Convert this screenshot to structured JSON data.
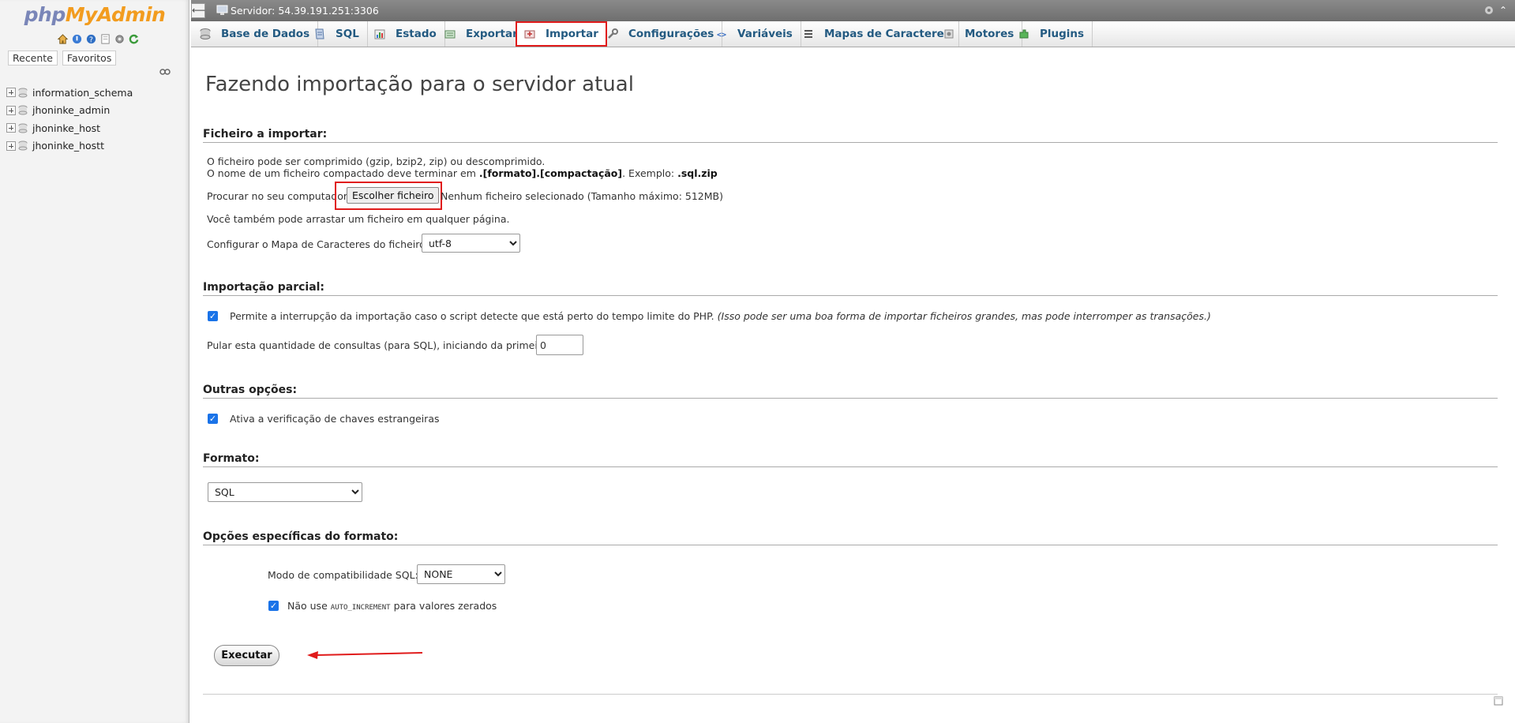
{
  "nav": {
    "logo": {
      "php": "php",
      "myadmin": "MyAdmin"
    },
    "tabs": {
      "recent": "Recente",
      "favorites": "Favoritos"
    },
    "databases": [
      "information_schema",
      "jhoninke_admin",
      "jhoninke_host",
      "jhoninke_hostt"
    ]
  },
  "server_bar": {
    "label": "Servidor: 54.39.191.251:3306"
  },
  "tabs": [
    {
      "label": "Base de Dados",
      "icon": "database-icon"
    },
    {
      "label": "SQL",
      "icon": "sql-icon"
    },
    {
      "label": "Estado",
      "icon": "status-icon"
    },
    {
      "label": "Exportar",
      "icon": "export-icon"
    },
    {
      "label": "Importar",
      "icon": "import-icon",
      "active": true
    },
    {
      "label": "Configurações",
      "icon": "wrench-icon"
    },
    {
      "label": "Variáveis",
      "icon": "variables-icon"
    },
    {
      "label": "Mapas de Caracteres",
      "icon": "charset-icon"
    },
    {
      "label": "Motores",
      "icon": "engine-icon"
    },
    {
      "label": "Plugins",
      "icon": "plugin-icon"
    }
  ],
  "page": {
    "title": "Fazendo importação para o servidor atual",
    "file_section": {
      "title": "Ficheiro a importar:",
      "line1": "O ficheiro pode ser comprimido (gzip, bzip2, zip) ou descomprimido.",
      "line2_pre": "O nome de um ficheiro compactado deve terminar em ",
      "line2_bold": ".[formato].[compactação]",
      "line2_mid": ". Exemplo: ",
      "line2_example": ".sql.zip",
      "browse_label": "Procurar no seu computador:",
      "choose_button": "Escolher ficheiro",
      "no_file": "Nenhum ficheiro selecionado (Tamanho máximo: 512MB)",
      "drag_hint": "Você também pode arrastar um ficheiro em qualquer página.",
      "charset_label": "Configurar o Mapa de Caracteres do ficheiro:",
      "charset_value": "utf-8"
    },
    "partial_section": {
      "title": "Importação parcial:",
      "interrupt_label": "Permite a interrupção da importação caso o script detecte que está perto do tempo limite do PHP.",
      "interrupt_note": "(Isso pode ser uma boa forma de importar ficheiros grandes, mas pode interromper as transações.)",
      "skip_label": "Pular esta quantidade de consultas (para SQL), iniciando da primeira:",
      "skip_value": "0"
    },
    "other_section": {
      "title": "Outras opções:",
      "fk_label": "Ativa a verificação de chaves estrangeiras"
    },
    "format_section": {
      "title": "Formato:",
      "value": "SQL"
    },
    "format_options_section": {
      "title": "Opções específicas do formato:",
      "compat_label": "Modo de compatibilidade SQL:",
      "compat_value": "NONE",
      "auto_inc_pre": "Não use ",
      "auto_inc_code": "AUTO_INCREMENT",
      "auto_inc_post": " para valores zerados"
    },
    "go_button": "Executar"
  },
  "colors": {
    "link_blue": "#235a81",
    "highlight_red": "#e01b1b",
    "checkbox_blue": "#1a73e8",
    "logo_php": "#7a86b8",
    "logo_myadmin": "#f29c1f"
  }
}
